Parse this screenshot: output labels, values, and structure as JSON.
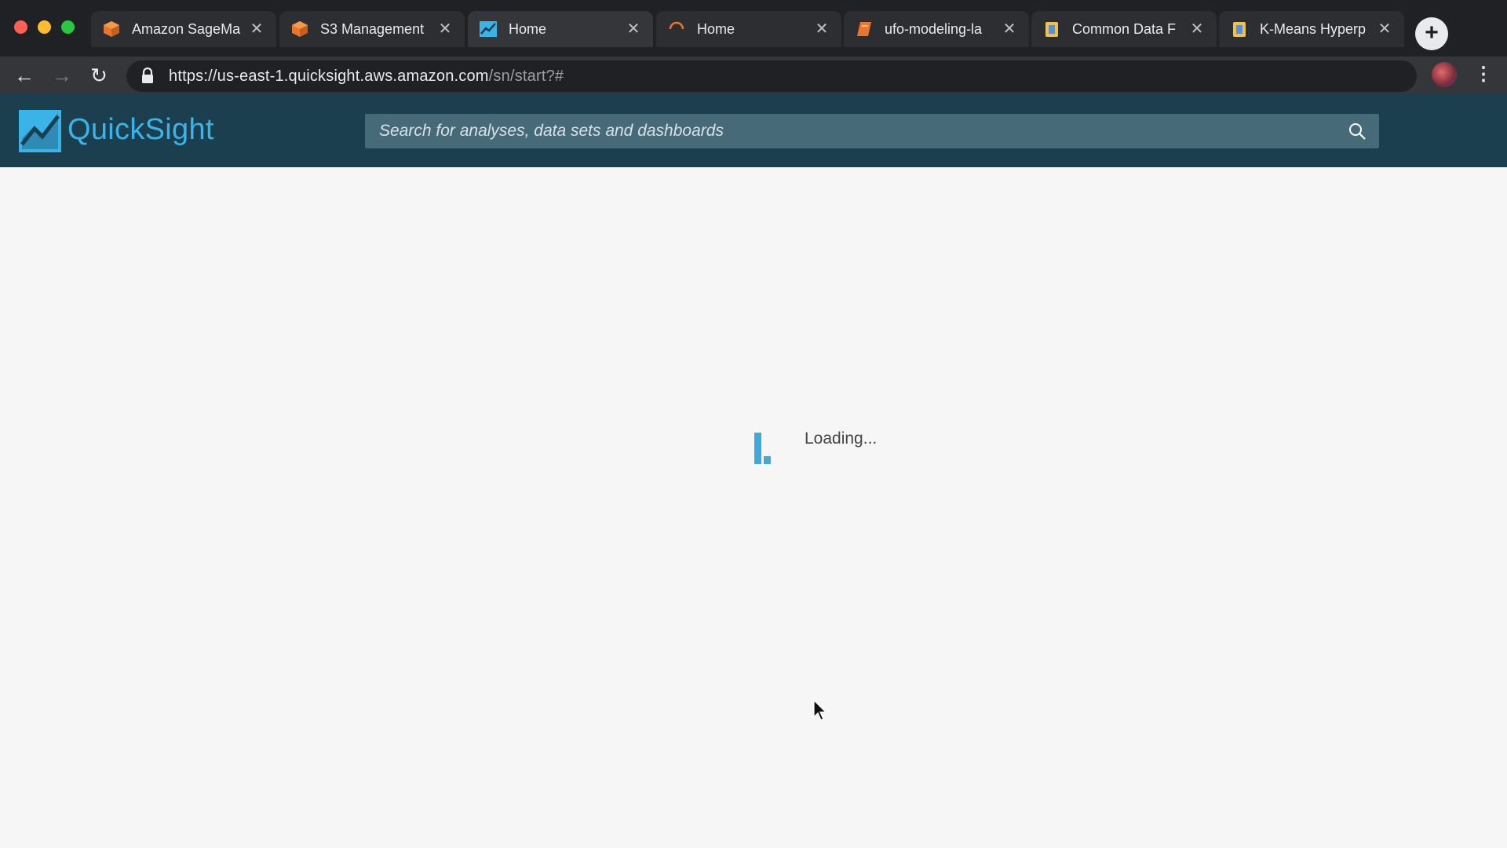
{
  "browser": {
    "tabs": [
      {
        "title": "Amazon SageMa",
        "icon": "aws-cube-icon"
      },
      {
        "title": "S3 Management",
        "icon": "aws-cube-icon"
      },
      {
        "title": "Home",
        "icon": "quicksight-icon",
        "active": true
      },
      {
        "title": "Home",
        "icon": "loading-spinner-icon"
      },
      {
        "title": "ufo-modeling-la",
        "icon": "notebook-icon"
      },
      {
        "title": "Common Data F",
        "icon": "docs-icon"
      },
      {
        "title": "K-Means Hyperp",
        "icon": "docs-icon"
      }
    ],
    "new_tab_label": "+",
    "url_host": "https://us-east-1.quicksight.aws.amazon.com",
    "url_path": "/sn/start?#"
  },
  "quicksight": {
    "brand": "QuickSight",
    "search_placeholder": "Search for analyses, data sets and dashboards",
    "brand_color": "#3ab4e8",
    "header_color": "#1b3f4f"
  },
  "main": {
    "loading_text": "Loading..."
  }
}
